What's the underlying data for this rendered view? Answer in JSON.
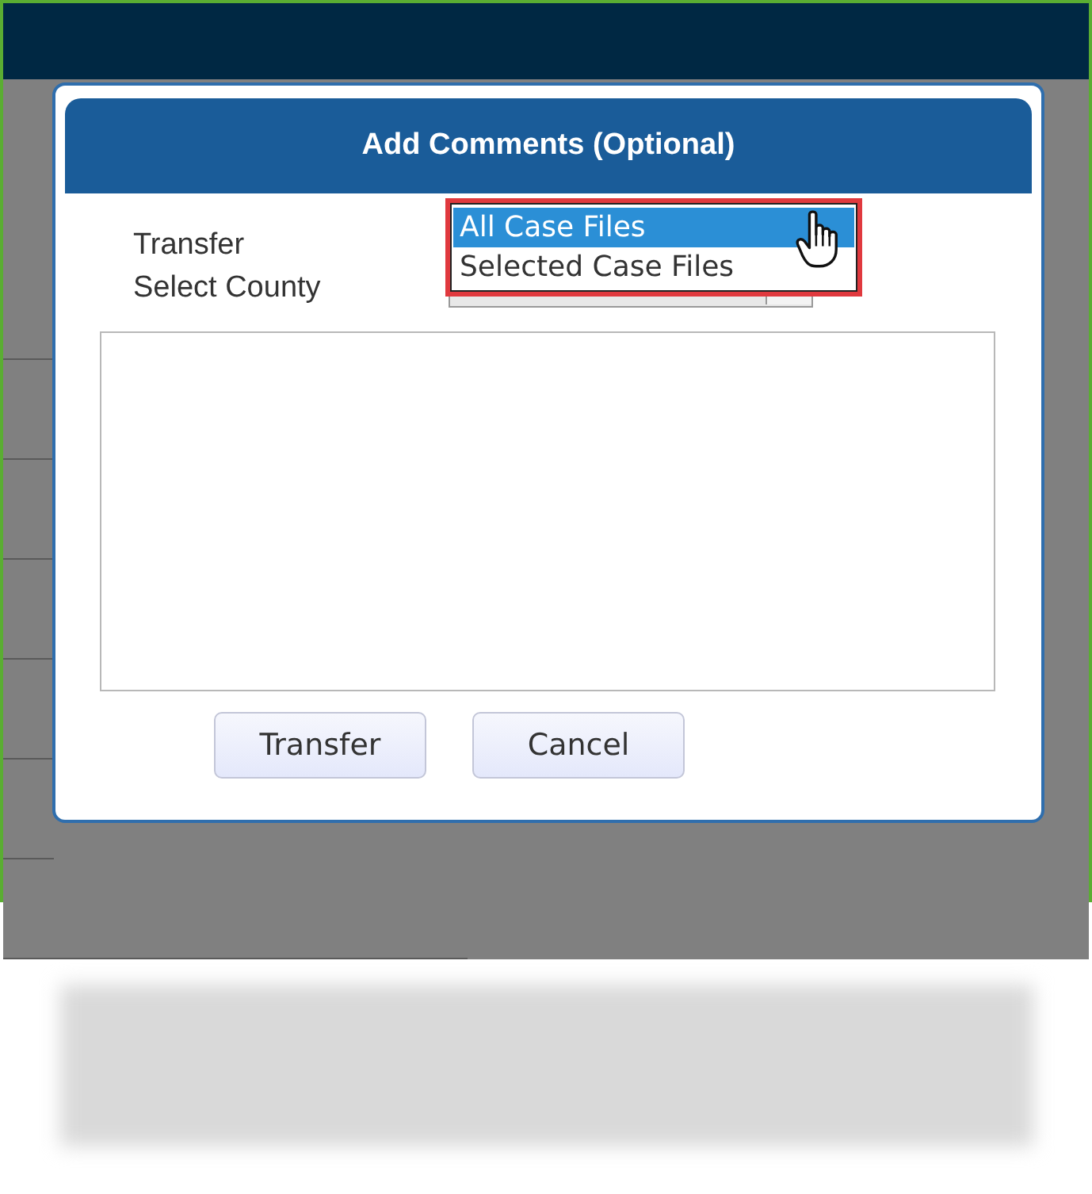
{
  "dialog": {
    "title": "Add Comments (Optional)",
    "fields": [
      {
        "label": "Transfer",
        "kind": "open-list",
        "options": [
          {
            "label": "All Case Files",
            "selected": true
          },
          {
            "label": "Selected Case Files",
            "selected": false
          }
        ]
      },
      {
        "label": "Select County",
        "kind": "covered-select"
      }
    ],
    "buttons": [
      "Transfer",
      "Cancel"
    ]
  }
}
